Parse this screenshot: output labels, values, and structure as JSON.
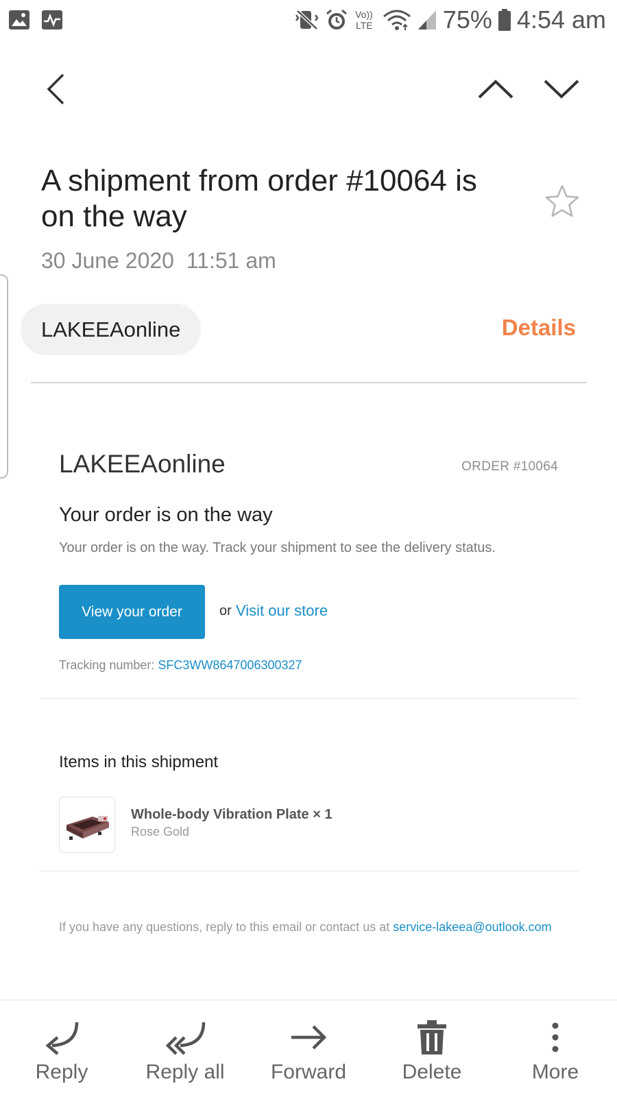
{
  "status_bar": {
    "battery": "75%",
    "time": "4:54 am",
    "network": "Vo)) LTE"
  },
  "message": {
    "subject": "A shipment from order #10064 is on the way",
    "date": "30 June 2020",
    "time": "11:51 am",
    "sender_chip": "LAKEEAonline",
    "details_label": "Details"
  },
  "email": {
    "store_name": "LAKEEAonline",
    "order_number": "ORDER #10064",
    "headline": "Your order is on the way",
    "lead": "Your order is on the way. Track your shipment to see the delivery status.",
    "cta_label": "View your order",
    "or_text": "or",
    "visit_store": "Visit our store",
    "tracking_label": "Tracking number:",
    "tracking_number": "SFC3WW8647006300327",
    "items_heading": "Items in this shipment",
    "item": {
      "title": "Whole-body Vibration Plate × 1",
      "variant": "Rose Gold"
    },
    "footer_text": "If you have any questions, reply to this email or contact us at",
    "footer_email": "service-lakeea@outlook.com"
  },
  "toolbar": {
    "reply": "Reply",
    "reply_all": "Reply all",
    "forward": "Forward",
    "delete": "Delete",
    "more": "More"
  },
  "colors": {
    "accent_orange": "#f0834a",
    "link_blue": "#1a8fc8",
    "cta_blue": "#1a8fc8"
  }
}
